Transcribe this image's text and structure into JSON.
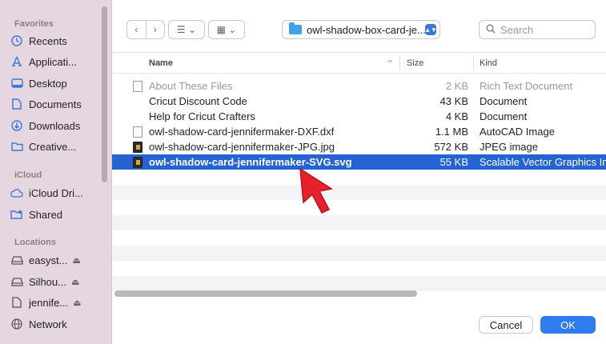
{
  "sidebar": {
    "favorites_header": "Favorites",
    "icloud_header": "iCloud",
    "locations_header": "Locations",
    "favorites": [
      {
        "label": "Recents",
        "icon": "clock-icon"
      },
      {
        "label": "Applicati...",
        "icon": "applications-icon"
      },
      {
        "label": "Desktop",
        "icon": "desktop-icon"
      },
      {
        "label": "Documents",
        "icon": "document-icon"
      },
      {
        "label": "Downloads",
        "icon": "download-icon"
      },
      {
        "label": "Creative...",
        "icon": "folder-icon"
      }
    ],
    "icloud": [
      {
        "label": "iCloud Dri...",
        "icon": "cloud-icon"
      },
      {
        "label": "Shared",
        "icon": "shared-folder-icon"
      }
    ],
    "locations": [
      {
        "label": "easyst...",
        "icon": "drive-icon",
        "eject": "⏏"
      },
      {
        "label": "Silhou...",
        "icon": "drive-icon",
        "eject": "⏏"
      },
      {
        "label": "jennife...",
        "icon": "file-icon",
        "eject": "⏏"
      },
      {
        "label": "Network",
        "icon": "network-icon"
      }
    ]
  },
  "toolbar": {
    "back": "‹",
    "forward": "›",
    "list_view": "☰ ⌄",
    "grid_view": "▦ ⌄",
    "folder_name": "owl-shadow-box-card-je...",
    "search_placeholder": "Search"
  },
  "columns": {
    "name": "Name",
    "size": "Size",
    "kind": "Kind",
    "sort_indicator": "⌃"
  },
  "files": [
    {
      "name": "About These Files",
      "size": "2 KB",
      "kind": "Rich Text Document",
      "state": "dim",
      "icon": "rtf-file-icon"
    },
    {
      "name": "Cricut Discount Code",
      "size": "43 KB",
      "kind": "Document",
      "state": "normal",
      "icon": "document-file-icon"
    },
    {
      "name": "Help for Cricut Crafters",
      "size": "4 KB",
      "kind": "Document",
      "state": "normal",
      "icon": "document-file-icon"
    },
    {
      "name": "owl-shadow-card-jennifermaker-DXF.dxf",
      "size": "1.1 MB",
      "kind": "AutoCAD Image",
      "state": "normal",
      "icon": "dxf-file-icon"
    },
    {
      "name": "owl-shadow-card-jennifermaker-JPG.jpg",
      "size": "572 KB",
      "kind": "JPEG image",
      "state": "normal",
      "icon": "jpg-file-icon"
    },
    {
      "name": "owl-shadow-card-jennifermaker-SVG.svg",
      "size": "55 KB",
      "kind": "Scalable Vector Graphics In",
      "state": "selected",
      "icon": "svg-file-icon"
    }
  ],
  "buttons": {
    "cancel": "Cancel",
    "ok": "OK"
  },
  "colors": {
    "selection": "#2463d1",
    "accent": "#2f7bf0",
    "sidebar_bg": "#e6d6e0",
    "cursor": "#e8202a"
  }
}
